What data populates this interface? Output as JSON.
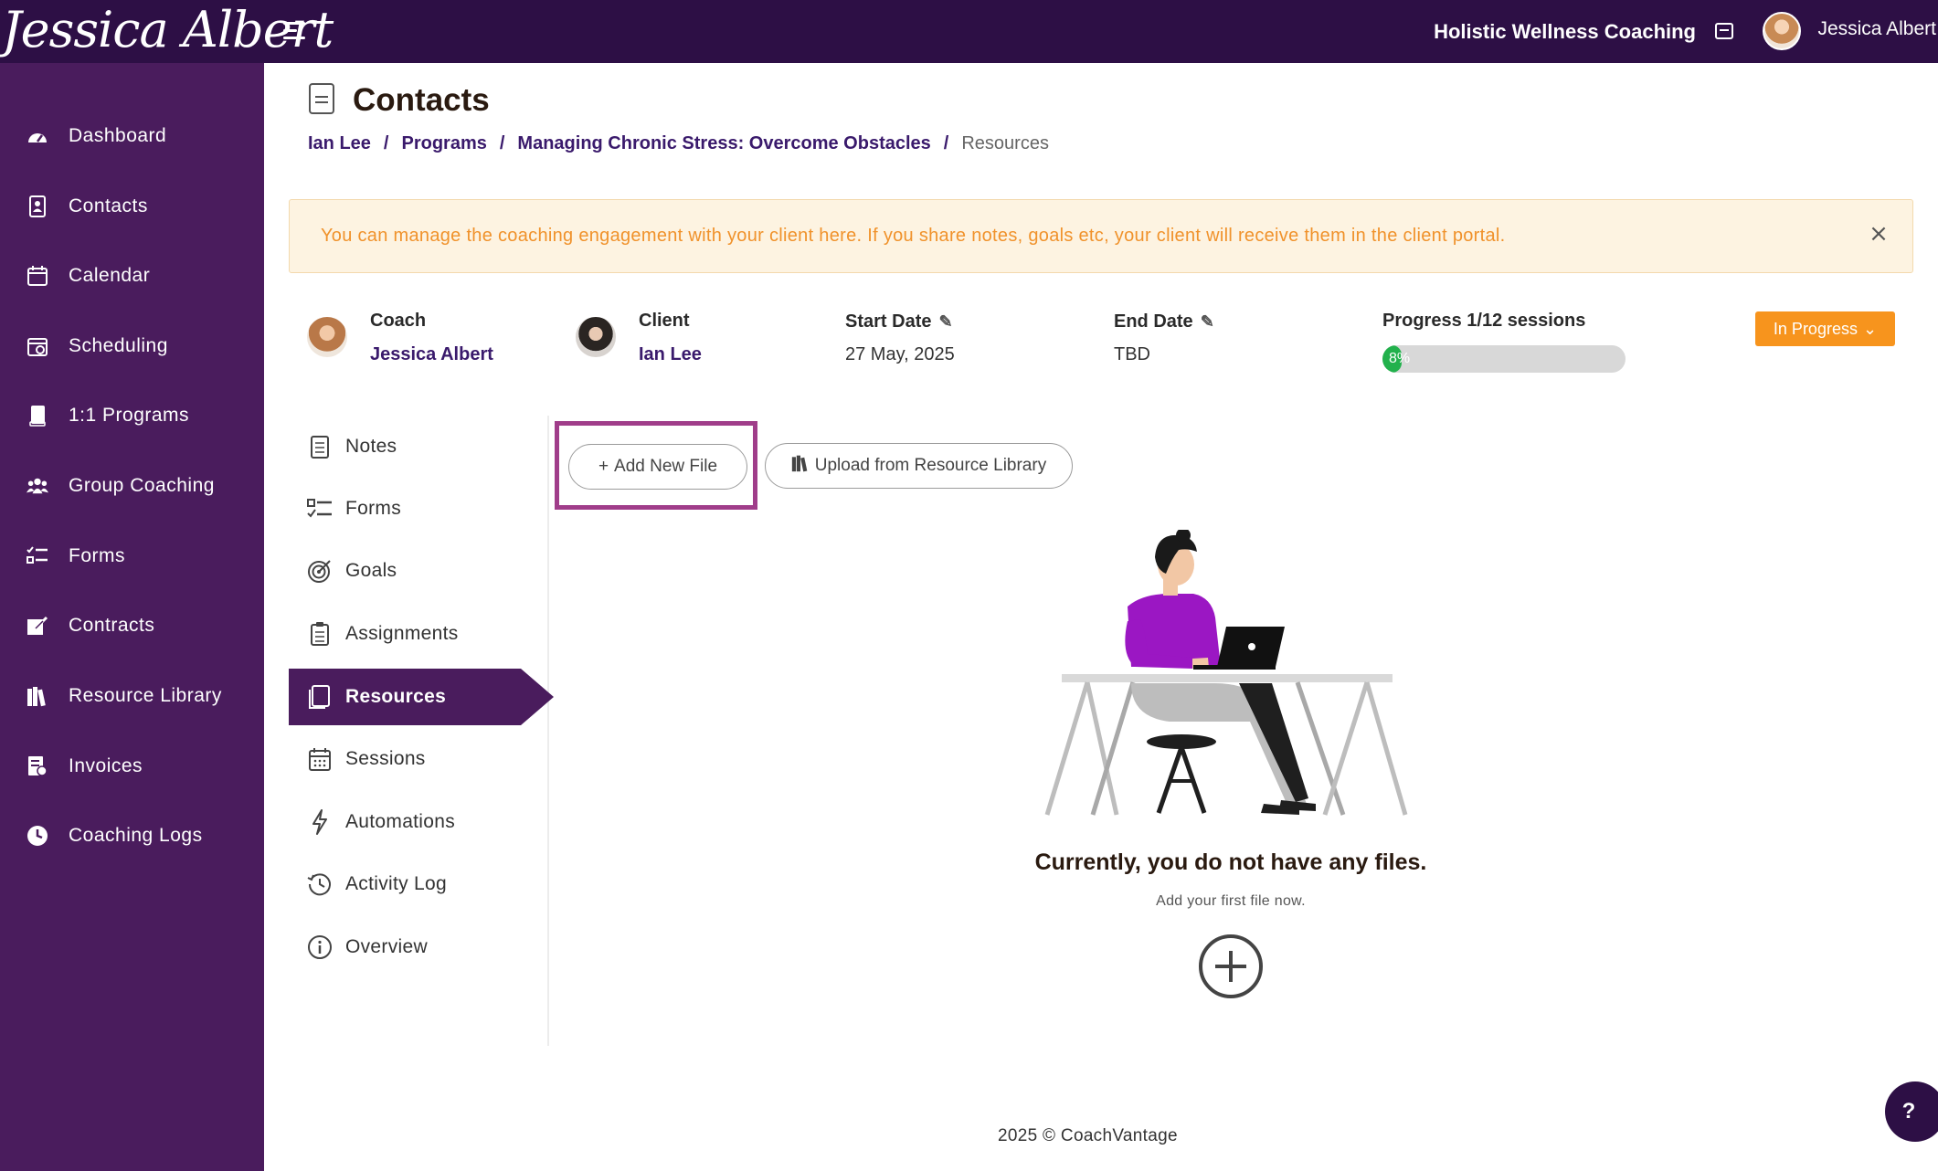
{
  "header": {
    "logo_text": "Jessica Albert",
    "business_name": "Holistic Wellness Coaching",
    "user_name": "Jessica Albert"
  },
  "sidebar": {
    "items": [
      {
        "label": "Dashboard",
        "icon": "dashboard-icon"
      },
      {
        "label": "Contacts",
        "icon": "contacts-icon"
      },
      {
        "label": "Calendar",
        "icon": "calendar-icon"
      },
      {
        "label": "Scheduling",
        "icon": "scheduling-icon"
      },
      {
        "label": "1:1 Programs",
        "icon": "programs-icon"
      },
      {
        "label": "Group Coaching",
        "icon": "group-icon"
      },
      {
        "label": "Forms",
        "icon": "forms-icon"
      },
      {
        "label": "Contracts",
        "icon": "contracts-icon"
      },
      {
        "label": "Resource Library",
        "icon": "library-icon"
      },
      {
        "label": "Invoices",
        "icon": "invoices-icon"
      },
      {
        "label": "Coaching Logs",
        "icon": "clock-icon"
      }
    ]
  },
  "page": {
    "title": "Contacts",
    "breadcrumb": [
      "Ian Lee",
      "Programs",
      "Managing Chronic Stress: Overcome Obstacles",
      "Resources"
    ],
    "breadcrumb_sep": "/"
  },
  "alert": {
    "text": "You can manage the coaching engagement with your client here. If you share notes, goals etc, your client will receive them in the client portal.",
    "close": "×"
  },
  "info": {
    "coach_label": "Coach",
    "coach_name": "Jessica Albert",
    "client_label": "Client",
    "client_name": "Ian Lee",
    "start_label": "Start Date",
    "start_value": "27 May, 2025",
    "end_label": "End Date",
    "end_value": "TBD",
    "progress_label": "Progress 1/12 sessions",
    "progress_text": "8%",
    "progress_fraction": 0.08,
    "status": "In Progress",
    "status_color": "#f7941d"
  },
  "subnav": {
    "items": [
      {
        "label": "Notes",
        "icon": "notes-icon",
        "active": false
      },
      {
        "label": "Forms",
        "icon": "forms-icon",
        "active": false
      },
      {
        "label": "Goals",
        "icon": "target-icon",
        "active": false
      },
      {
        "label": "Assignments",
        "icon": "clipboard-icon",
        "active": false
      },
      {
        "label": "Resources",
        "icon": "resources-icon",
        "active": true
      },
      {
        "label": "Sessions",
        "icon": "calendar-icon",
        "active": false
      },
      {
        "label": "Automations",
        "icon": "bolt-icon",
        "active": false
      },
      {
        "label": "Activity Log",
        "icon": "history-icon",
        "active": false
      },
      {
        "label": "Overview",
        "icon": "info-icon",
        "active": false
      }
    ]
  },
  "actions": {
    "add_file": "Add New File",
    "upload": "Upload from Resource Library"
  },
  "empty_state": {
    "title": "Currently, you do not have any files.",
    "subtitle": "Add your first file now."
  },
  "footer": {
    "text": "2025 © CoachVantage"
  },
  "help": "?",
  "colors": {
    "header_bg": "#2d0f45",
    "sidebar_bg": "#4a1c5d",
    "accent_link": "#3a1a6c",
    "alert_text": "#f0922b",
    "progress_fill": "#22b14c",
    "highlight": "#a03d8a"
  }
}
